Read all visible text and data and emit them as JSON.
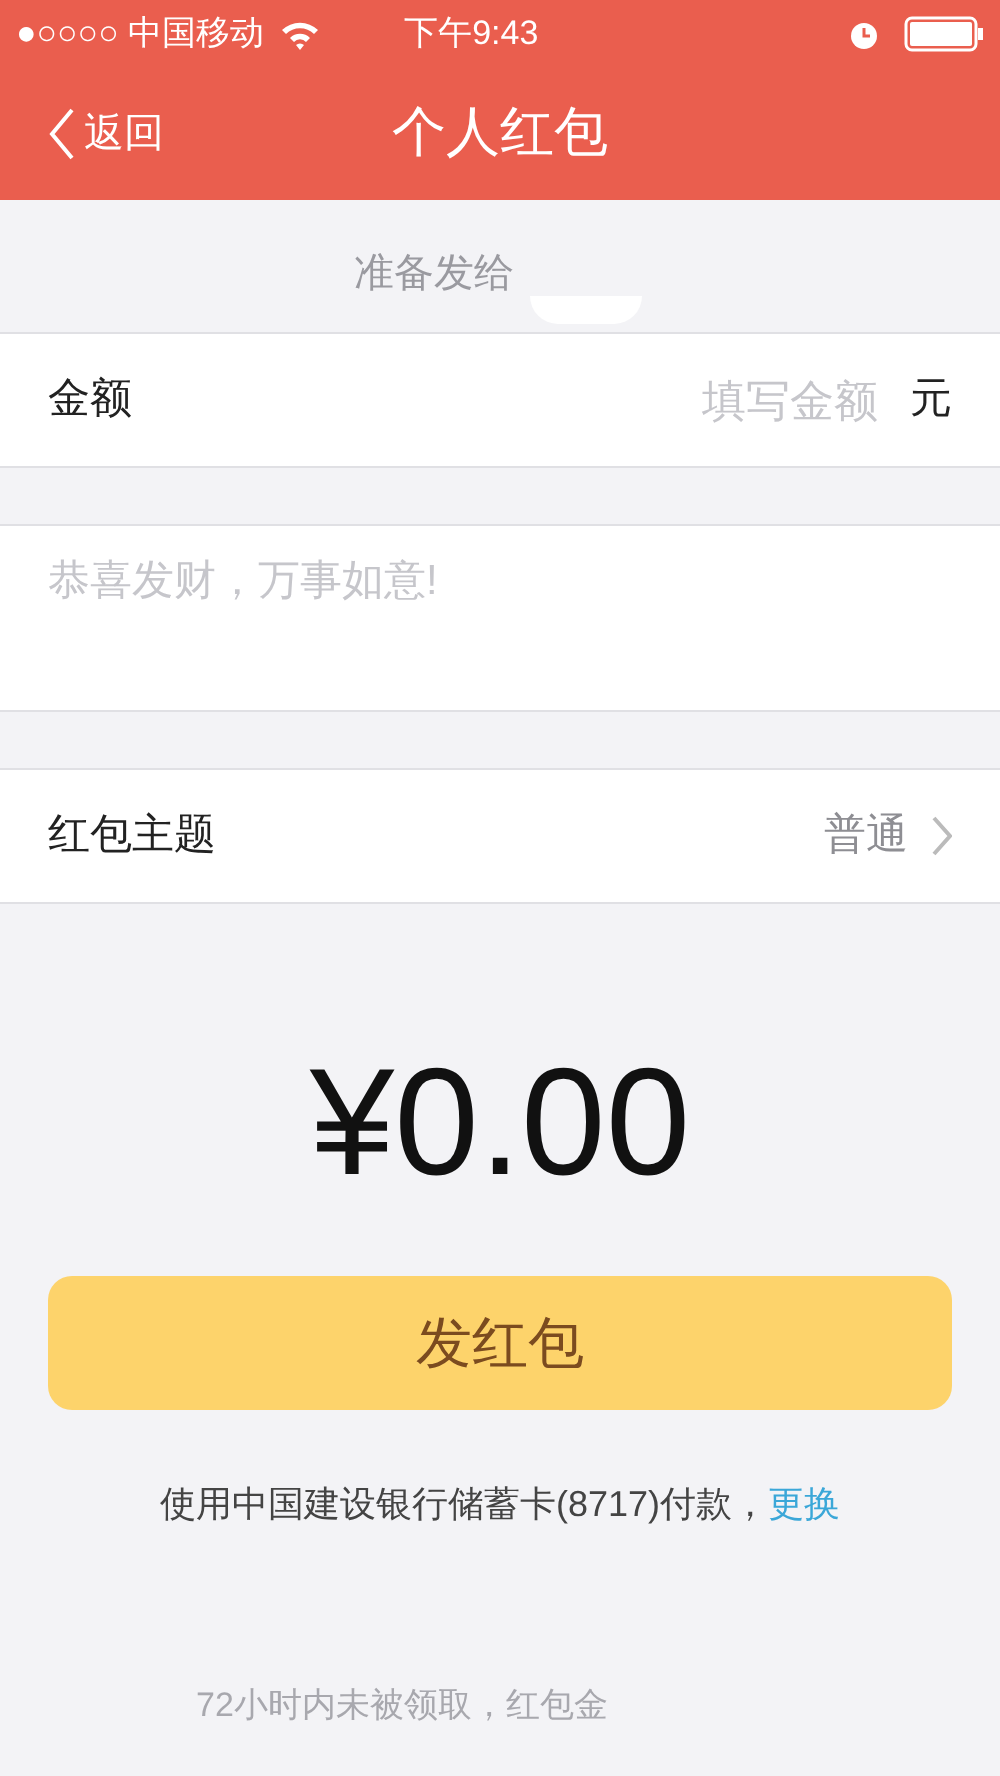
{
  "status_bar": {
    "carrier": "●○○○○ 中国移动",
    "time": "下午9:43"
  },
  "nav": {
    "back": "返回",
    "title": "个人红包"
  },
  "recipient": {
    "label": "准备发给"
  },
  "amount": {
    "label": "金额",
    "placeholder": "填写金额",
    "unit": "元"
  },
  "message": {
    "placeholder": "恭喜发财，万事如意!"
  },
  "theme": {
    "label": "红包主题",
    "value": "普通"
  },
  "total": "¥0.00",
  "send_button": "发红包",
  "payment": {
    "text": "使用中国建设银行储蓄卡(8717)付款，",
    "link": "更换"
  },
  "footer": "72小时内未被领取，红包金"
}
